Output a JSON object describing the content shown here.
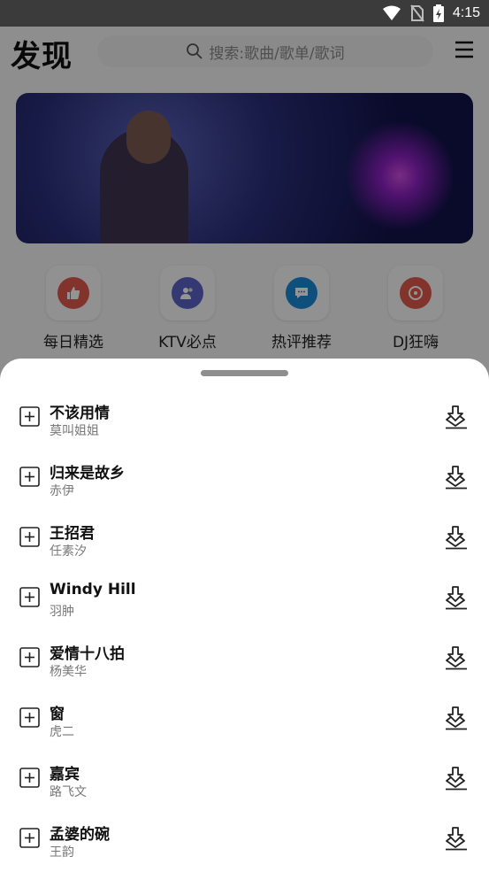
{
  "status_bar": {
    "time": "4:15"
  },
  "header": {
    "logo": "发现",
    "search_placeholder": "搜索:歌曲/歌单/歌词"
  },
  "quick_links": [
    {
      "label": "每日精选",
      "icon": "thumbs-up-icon",
      "color": "#e0584a"
    },
    {
      "label": "KTV必点",
      "icon": "users-icon",
      "color": "#5c63c7"
    },
    {
      "label": "热评推荐",
      "icon": "comment-icon",
      "color": "#1a88d6"
    },
    {
      "label": "DJ狂嗨",
      "icon": "disc-icon",
      "color": "#e0584a"
    }
  ],
  "songs": [
    {
      "title": "不该用情",
      "artist": "莫叫姐姐"
    },
    {
      "title": "归来是故乡",
      "artist": "赤伊"
    },
    {
      "title": "王招君",
      "artist": "任素汐"
    },
    {
      "title": "Windy Hill",
      "artist": "羽肿"
    },
    {
      "title": "爱情十八拍",
      "artist": "杨美华"
    },
    {
      "title": "窗",
      "artist": "虎二"
    },
    {
      "title": "嘉宾",
      "artist": "路飞文"
    },
    {
      "title": "孟婆的碗",
      "artist": "王韵"
    }
  ]
}
